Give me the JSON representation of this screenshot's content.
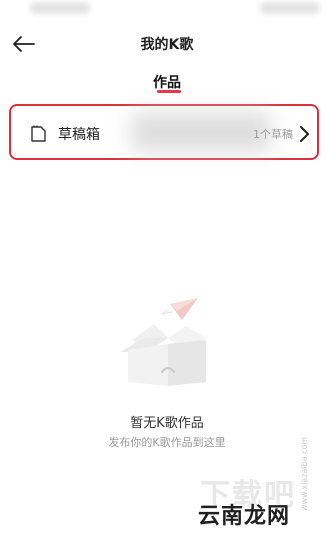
{
  "header": {
    "title": "我的K歌",
    "back_icon": "arrow-left-icon"
  },
  "tabs": [
    {
      "label": "作品",
      "active": true
    }
  ],
  "drafts": {
    "label": "草稿箱",
    "count_text": "1个草稿",
    "icon": "folder-icon",
    "chevron_icon": "chevron-right-icon"
  },
  "empty_state": {
    "illustration_icon": "empty-box-with-paper-plane-icon",
    "title": "暂无K歌作品",
    "subtitle": "发布你的K歌作品到这里"
  },
  "watermark": {
    "text": "云南龙网",
    "url": "www.xiazaiba.com"
  },
  "colors": {
    "accent": "#e8344a",
    "highlight_border": "#d8323c",
    "secondary_text": "#9a9a9a"
  }
}
